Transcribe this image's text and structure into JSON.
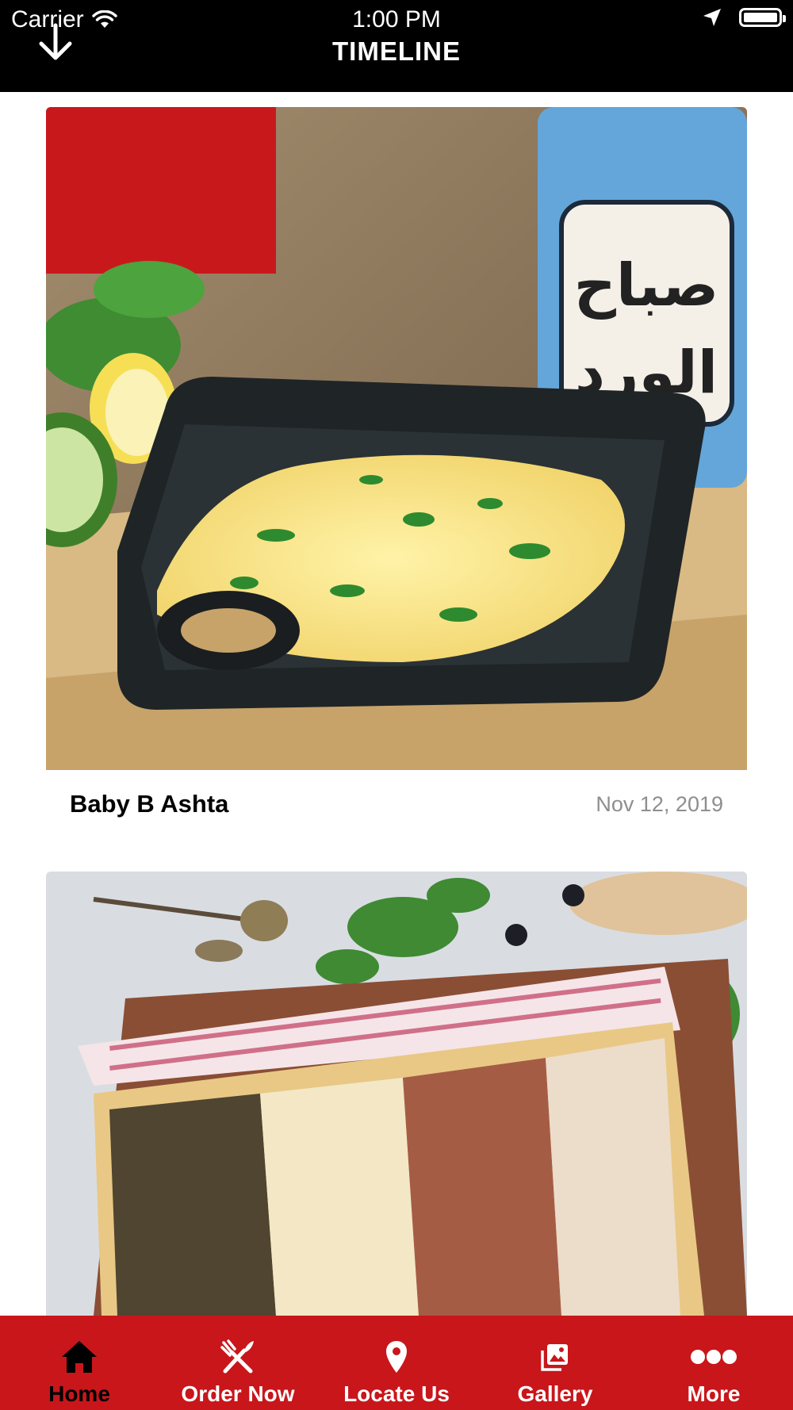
{
  "status_bar": {
    "carrier": "Carrier",
    "time": "1:00 PM",
    "icons": [
      "wifi-icon",
      "location-arrow-icon",
      "battery-icon"
    ]
  },
  "header": {
    "title": "TIMELINE",
    "left_icon": "arrow-down-icon"
  },
  "feed": {
    "posts": [
      {
        "title": "Baby B Ashta",
        "date": "Nov 12, 2019",
        "image": "scrambled eggs in cast-iron skillet photo"
      },
      {
        "title": "",
        "date": "",
        "image": "manakish flatbread with four toppings photo"
      }
    ]
  },
  "tab_bar": {
    "active_color": "#000000",
    "background": "#c8161b",
    "items": [
      {
        "label": "Home",
        "icon": "home-icon",
        "active": true
      },
      {
        "label": "Order Now",
        "icon": "fork-knife-icon",
        "active": false
      },
      {
        "label": "Locate Us",
        "icon": "map-pin-icon",
        "active": false
      },
      {
        "label": "Gallery",
        "icon": "gallery-icon",
        "active": false
      },
      {
        "label": "More",
        "icon": "more-dots-icon",
        "active": false
      }
    ]
  }
}
